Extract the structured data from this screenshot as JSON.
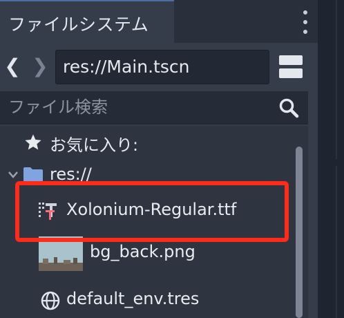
{
  "filesystem_dock": {
    "tab_title": "ファイルシステム",
    "nav_back": "❮",
    "nav_forward": "❯",
    "current_path": "res://Main.tscn",
    "search": {
      "placeholder": "ファイル検索",
      "value": ""
    },
    "tree": {
      "favorites_label": "お気に入り:",
      "root_label": "res://",
      "files": [
        {
          "name": "Xolonium-Regular.ttf",
          "icon": "font-file-icon"
        },
        {
          "name": "bg_back.png",
          "icon": "image-thumbnail"
        },
        {
          "name": "default_env.tres",
          "icon": "environment-globe-icon"
        }
      ]
    },
    "highlight_color": "#ff2a1a",
    "accent_color": "#4d6ea5"
  }
}
